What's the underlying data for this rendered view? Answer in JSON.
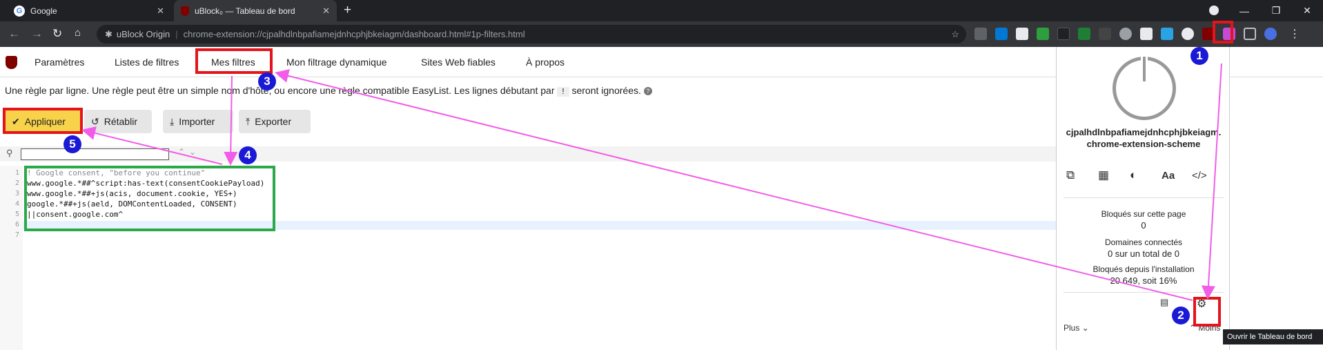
{
  "browser": {
    "tabs": [
      {
        "title": "Google"
      },
      {
        "title": "uBlock₀ — Tableau de bord"
      }
    ],
    "address": {
      "site": "uBlock Origin",
      "url": "chrome-extension://cjpalhdlnbpafiamejdnhcphjbkeiagm/dashboard.html#1p-filters.html"
    }
  },
  "dashboard": {
    "nav": [
      "Paramètres",
      "Listes de filtres",
      "Mes filtres",
      "Mon filtrage dynamique",
      "Sites Web fiables",
      "À propos"
    ],
    "description_a": "Une règle par ligne. Une règle peut être un simple nom d'hôte, ou encore une règle compatible EasyList. Les lignes débutant par",
    "description_kbd": "!",
    "description_b": "seront ignorées.",
    "buttons": {
      "apply": "Appliquer",
      "revert": "Rétablir",
      "import": "Importer",
      "export": "Exporter"
    },
    "line_numbers": [
      "1",
      "2",
      "3",
      "4",
      "5",
      "6",
      "7"
    ],
    "code_lines": [
      "! Google consent, \"before you continue\"",
      "www.google.*##^script:has-text(consentCookiePayload)",
      "www.google.*##+js(acis, document.cookie, YES+)",
      "google.*##+js(aeld, DOMContentLoaded, CONSENT)",
      "||consent.google.com^"
    ]
  },
  "popup": {
    "hostname_1": "cjpalhdlnbpafiamejdnhcphjbkeiagm.",
    "hostname_2": "chrome-extension-scheme",
    "blocked_page_label": "Bloqués sur cette page",
    "blocked_page_value": "0",
    "domains_label": "Domaines connectés",
    "domains_value": "0 sur un total de 0",
    "blocked_install_label": "Bloqués depuis l'installation",
    "blocked_install_value": "20 649, soit 16%",
    "more": "Plus",
    "less": "Moins",
    "tooltip": "Ouvrir le Tableau de bord"
  },
  "annotations": {
    "step_numbers": [
      "1",
      "2",
      "3",
      "4",
      "5"
    ]
  },
  "colors": {
    "red": "#e3141b",
    "green": "#2ba84a",
    "arrow": "#f25ce8",
    "badge": "#1a1ad6"
  }
}
